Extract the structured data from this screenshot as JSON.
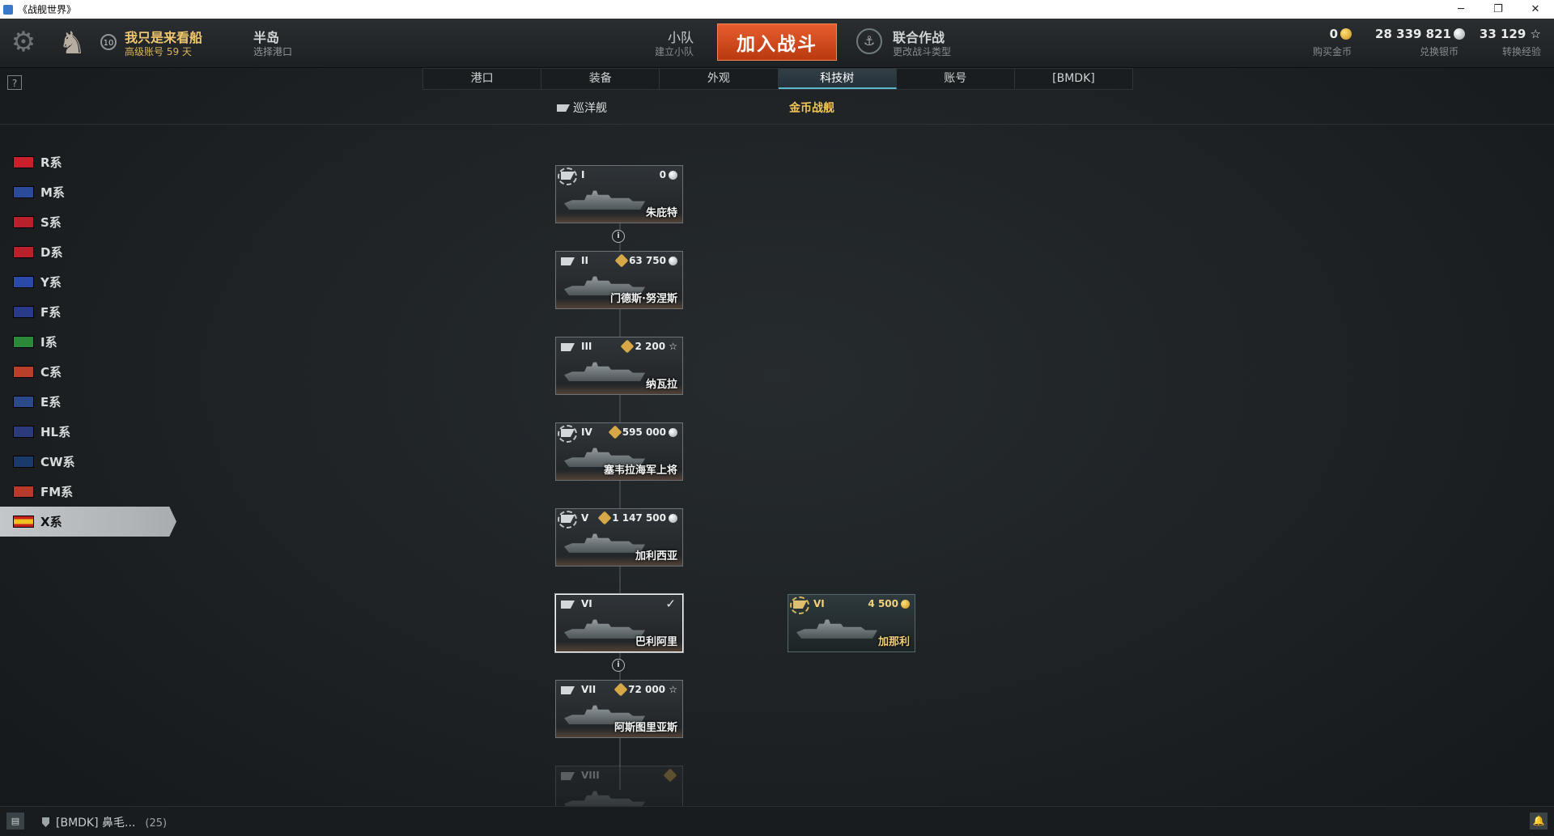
{
  "window": {
    "title": "《战舰世界》",
    "minimize": "─",
    "restore": "❐",
    "close": "✕"
  },
  "topbar": {
    "settings_icon": "⚙",
    "emblem_icon": "♞",
    "level": "10",
    "username": "我只是来看船",
    "account_status": "高级账号 59 天",
    "port_name": "半岛",
    "port_sub": "选择港口",
    "squad": "小队",
    "squad_sub": "建立小队",
    "battle_button": "加入战斗",
    "mode": "联合作战",
    "mode_sub": "更改战斗类型",
    "gold_value": "0",
    "gold_label": "购买金币",
    "silver_value": "28 339 821",
    "silver_label": "兑换银币",
    "xp_value": "33 129",
    "xp_label": "转换经验",
    "star_icon": "☆"
  },
  "help_button": "?",
  "tabs": [
    "港口",
    "装备",
    "外观",
    "科技树",
    "账号",
    "[BMDK]"
  ],
  "active_tab": "科技树",
  "subtabs": {
    "cruisers": "巡洋舰",
    "premium": "金币战舰"
  },
  "nations": [
    {
      "label": "R系",
      "color": "#c8202a"
    },
    {
      "label": "M系",
      "color": "#2a4a9a"
    },
    {
      "label": "S系",
      "color": "#b8202a"
    },
    {
      "label": "D系",
      "color": "#b8202a"
    },
    {
      "label": "Y系",
      "color": "#2a4aa8"
    },
    {
      "label": "F系",
      "color": "#2a3a8a"
    },
    {
      "label": "I系",
      "color": "#2a8a3a"
    },
    {
      "label": "C系",
      "color": "#b8402a"
    },
    {
      "label": "E系",
      "color": "#2a4a8a"
    },
    {
      "label": "HL系",
      "color": "#2a3a7a"
    },
    {
      "label": "CW系",
      "color": "#1a3a6a"
    },
    {
      "label": "FM系",
      "color": "#b83a2a"
    },
    {
      "label": "X系",
      "color": "#d8201a"
    }
  ],
  "active_nation": "X系",
  "ships": [
    {
      "tier": "I",
      "cost": "0",
      "name": "朱庇特"
    },
    {
      "tier": "II",
      "cost": "63 750",
      "name": "门德斯·努涅斯"
    },
    {
      "tier": "III",
      "cost": "2 200",
      "name": "纳瓦拉"
    },
    {
      "tier": "IV",
      "cost": "595 000",
      "name": "塞韦拉海军上将"
    },
    {
      "tier": "V",
      "cost": "1 147 500",
      "name": "加利西亚"
    },
    {
      "tier": "VI",
      "check": "✓",
      "name": "巴利阿里"
    },
    {
      "tier": "VII",
      "cost": "72 000",
      "name": "阿斯图里亚斯"
    },
    {
      "tier": "VIII"
    }
  ],
  "premium_ship": {
    "tier": "VI",
    "cost": "4 500",
    "name": "加那利"
  },
  "info_icon": "i",
  "bottombar": {
    "chat_icon": "▤",
    "clan": "[BMDK] 鼻毛...",
    "count": "(25)",
    "bell_icon": "🔔"
  },
  "colors": {
    "accent_orange": "#d84c1f",
    "gold_text": "#f1c55a",
    "tab_active": "#5eb7c9"
  }
}
